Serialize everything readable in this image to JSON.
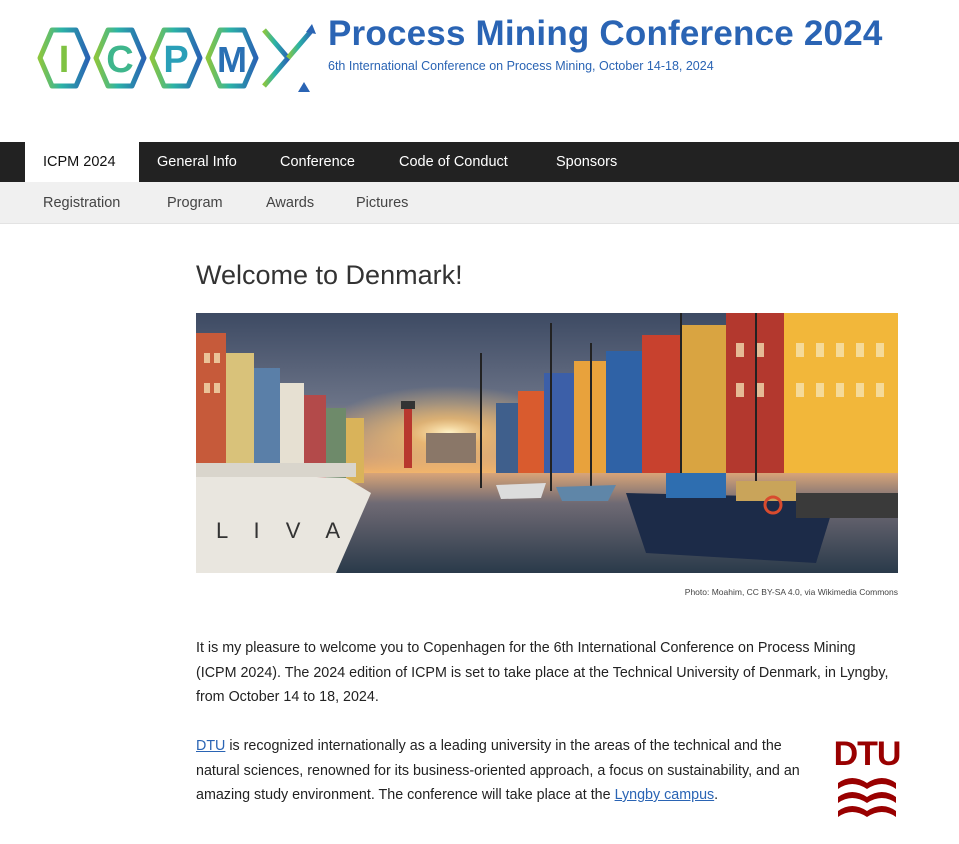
{
  "header": {
    "logo_text": "ICPM",
    "title": "Process Mining Conference 2024",
    "subtitle": "6th International Conference on Process Mining, October 14-18, 2024"
  },
  "primary_nav": [
    {
      "label": "ICPM 2024",
      "active": true
    },
    {
      "label": "General Info",
      "active": false
    },
    {
      "label": "Conference",
      "active": false
    },
    {
      "label": "Code of Conduct",
      "active": false
    },
    {
      "label": "Sponsors",
      "active": false
    }
  ],
  "secondary_nav": [
    {
      "label": "Registration"
    },
    {
      "label": "Program"
    },
    {
      "label": "Awards"
    },
    {
      "label": "Pictures"
    }
  ],
  "main": {
    "title": "Welcome to Denmark!",
    "photo_caption": "Photo: Moahim, CC BY-SA 4.0, via Wikimedia Commons",
    "boat_lettering": "L I V A",
    "paragraph1": "It is my pleasure to welcome you to Copenhagen for the 6th International Conference on Process Mining (ICPM 2024). The 2024 edition of ICPM is set to take place at the Technical University of Denmark, in Lyngby, from October 14 to 18, 2024.",
    "paragraph2": {
      "link1": "DTU",
      "text1": " is recognized internationally as a leading university in the areas of the technical and the natural sciences, renowned for its business-oriented approach, a focus on sustainability, and an amazing study environment. The conference will take place at the ",
      "link2": "Lyngby campus",
      "text2": "."
    },
    "dtu_logo_text": "DTU"
  },
  "colors": {
    "brand_blue": "#2a64b4",
    "nav_dark": "#222222",
    "dtu_red": "#990000"
  }
}
